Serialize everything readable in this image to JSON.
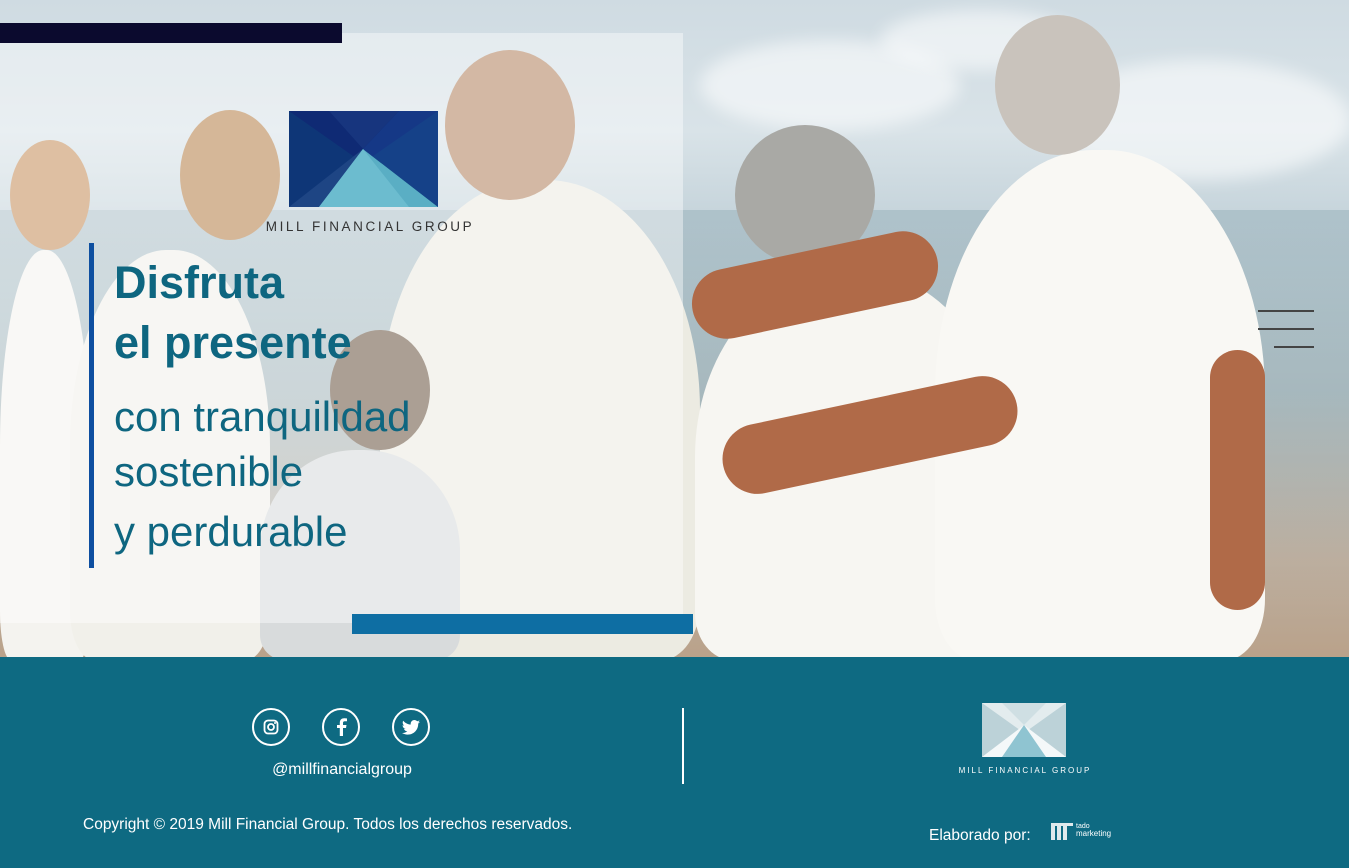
{
  "brand": {
    "name": "MILL FINANCIAL GROUP",
    "colors": {
      "primary": "#0e6680",
      "footer": "#0e6a82",
      "accent_blue": "#0e6ea3",
      "navy": "#0b0a2e",
      "logo_dark": "#0f2a74",
      "logo_light": "#5aaec4"
    }
  },
  "hero": {
    "headline_line1": "Disfruta",
    "headline_line2": "el presente",
    "sub_line1": "con tranquilidad",
    "sub_line2": "sostenible",
    "sub_line3": "y perdurable"
  },
  "nav": {
    "menu_icon": "hamburger-menu-icon"
  },
  "footer": {
    "social_icons": [
      "instagram-icon",
      "facebook-icon",
      "twitter-icon"
    ],
    "handle": "@millfinancialgroup",
    "copyright": "Copyright © 2019 Mill Financial Group. Todos los derechos reservados.",
    "logo_text": "MILL FINANCIAL GROUP",
    "made_by_label": "Elaborado por:",
    "agency_text_top": "tado",
    "agency_text_bottom": "marketing"
  }
}
